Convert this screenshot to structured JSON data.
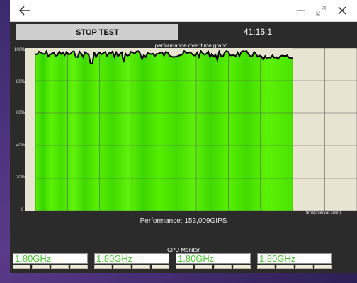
{
  "window": {
    "buttons": {
      "back": "back-arrow-icon",
      "minimize": "minimize-icon",
      "maximize": "maximize-icon",
      "close": "close-icon"
    }
  },
  "controls": {
    "stop_label": "STOP TEST",
    "timer": "41:16:1"
  },
  "graph": {
    "title": "performance over time graph",
    "y_ticks": [
      "100%",
      "80%",
      "60%",
      "40%",
      "20%",
      "0"
    ],
    "x_label": "time(interval 5min)",
    "progress_fraction": 0.8,
    "line_color": "#000000",
    "fill_color": "#55f000",
    "bg_color": "#e8e4d2"
  },
  "performance_text": "Performance: 153,009GIPS",
  "cpu_monitor": {
    "title": "CPU Monitor",
    "cores": [
      {
        "freq": "1.80GHz"
      },
      {
        "freq": "1.80GHz"
      },
      {
        "freq": "1.80GHz"
      },
      {
        "freq": "1.80GHz"
      }
    ]
  }
}
